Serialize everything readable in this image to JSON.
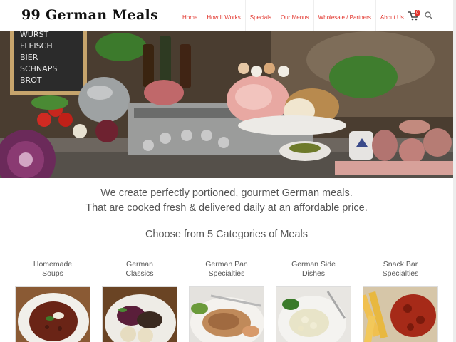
{
  "header": {
    "logo": "99 German Meals",
    "nav": [
      "Home",
      "How It Works",
      "Specials",
      "Our Menus",
      "Wholesale / Partners",
      "About Us"
    ],
    "cart_count": "0"
  },
  "hero": {
    "chalkboard_lines": [
      "WURST",
      "FLEISCH",
      "BIER",
      "SCHNAPS",
      "BROT"
    ]
  },
  "intro": {
    "line1": "We create perfectly portioned, gourmet German meals.",
    "line2": "That are cooked fresh & delivered daily at an affordable price."
  },
  "categories_title": "Choose from 5 Categories of Meals",
  "categories": [
    {
      "line1": "Homemade",
      "line2": "Soups"
    },
    {
      "line1": "German",
      "line2": "Classics"
    },
    {
      "line1": "German Pan",
      "line2": "Specialties"
    },
    {
      "line1": "German Side",
      "line2": "Dishes"
    },
    {
      "line1": "Snack Bar",
      "line2": "Specialties"
    }
  ],
  "colors": {
    "accent": "#e2332b"
  }
}
